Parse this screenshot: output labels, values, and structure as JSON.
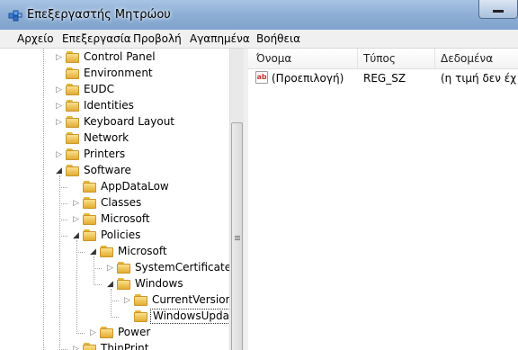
{
  "window": {
    "title": "Επεξεργαστής Μητρώου"
  },
  "menu": [
    "Αρχείο",
    "Επεξεργασία",
    "Προβολή",
    "Αγαπημένα",
    "Βοήθεια"
  ],
  "tree": {
    "nodes": [
      {
        "label": "Control Panel",
        "depth": 0,
        "toggle": "collapsed"
      },
      {
        "label": "Environment",
        "depth": 0,
        "toggle": "none"
      },
      {
        "label": "EUDC",
        "depth": 0,
        "toggle": "collapsed"
      },
      {
        "label": "Identities",
        "depth": 0,
        "toggle": "collapsed"
      },
      {
        "label": "Keyboard Layout",
        "depth": 0,
        "toggle": "collapsed"
      },
      {
        "label": "Network",
        "depth": 0,
        "toggle": "none"
      },
      {
        "label": "Printers",
        "depth": 0,
        "toggle": "collapsed"
      },
      {
        "label": "Software",
        "depth": 0,
        "toggle": "expanded"
      },
      {
        "label": "AppDataLow",
        "depth": 1,
        "toggle": "none"
      },
      {
        "label": "Classes",
        "depth": 1,
        "toggle": "collapsed"
      },
      {
        "label": "Microsoft",
        "depth": 1,
        "toggle": "collapsed"
      },
      {
        "label": "Policies",
        "depth": 1,
        "toggle": "expanded"
      },
      {
        "label": "Microsoft",
        "depth": 2,
        "toggle": "expanded"
      },
      {
        "label": "SystemCertificates",
        "depth": 3,
        "toggle": "collapsed"
      },
      {
        "label": "Windows",
        "depth": 3,
        "toggle": "expanded"
      },
      {
        "label": "CurrentVersion",
        "depth": 4,
        "toggle": "collapsed"
      },
      {
        "label": "WindowsUpdate",
        "depth": 4,
        "toggle": "none",
        "selected": true
      },
      {
        "label": "Power",
        "depth": 2,
        "toggle": "collapsed"
      },
      {
        "label": "ThinPrint",
        "depth": 1,
        "toggle": "collapsed"
      }
    ]
  },
  "list": {
    "columns": [
      "Όνομα",
      "Τύπος",
      "Δεδομένα"
    ],
    "rows": [
      {
        "icon": "string-value-icon",
        "icon_text": "ab",
        "name": "(Προεπιλογή)",
        "type": "REG_SZ",
        "data": "(η τιμή δεν έχ"
      }
    ]
  },
  "colors": {
    "folder": "#f0c44c",
    "titlebar": "#8fb0d6",
    "accent_icon": "#c0392b"
  }
}
